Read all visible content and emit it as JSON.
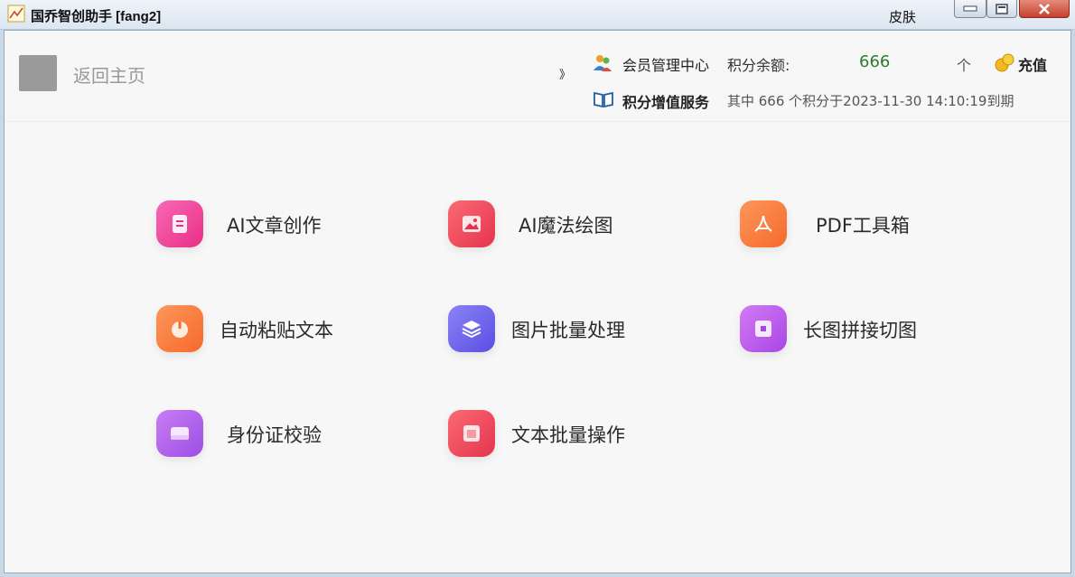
{
  "window": {
    "title": "国乔智创助手 [fang2]",
    "skin_label": "皮肤"
  },
  "header": {
    "back_label": "返回主页",
    "quote_mark": "》",
    "member_center": "会员管理中心",
    "balance_label": "积分余额:",
    "balance_value": "666",
    "unit_label": "个",
    "recharge_label": "充值",
    "value_added_service": "积分增值服务",
    "expiry_text": "其中 666 个积分于2023-11-30 14:10:19到期"
  },
  "tools": [
    {
      "label": "AI文章创作",
      "icon": "document-icon",
      "color": "#f0449a"
    },
    {
      "label": "AI魔法绘图",
      "icon": "image-icon",
      "color": "#f0475f"
    },
    {
      "label": "PDF工具箱",
      "icon": "pdf-icon",
      "color": "#fb7a3b"
    },
    {
      "label": "自动粘贴文本",
      "icon": "power-icon",
      "color": "#fb7a3b"
    },
    {
      "label": "图片批量处理",
      "icon": "layers-icon",
      "color": "#6b63ec"
    },
    {
      "label": "长图拼接切图",
      "icon": "square-icon",
      "color": "#c056ec"
    },
    {
      "label": "身份证校验",
      "icon": "id-card-icon",
      "color": "#b55be8"
    },
    {
      "label": "文本批量操作",
      "icon": "text-batch-icon",
      "color": "#f0475f"
    }
  ]
}
